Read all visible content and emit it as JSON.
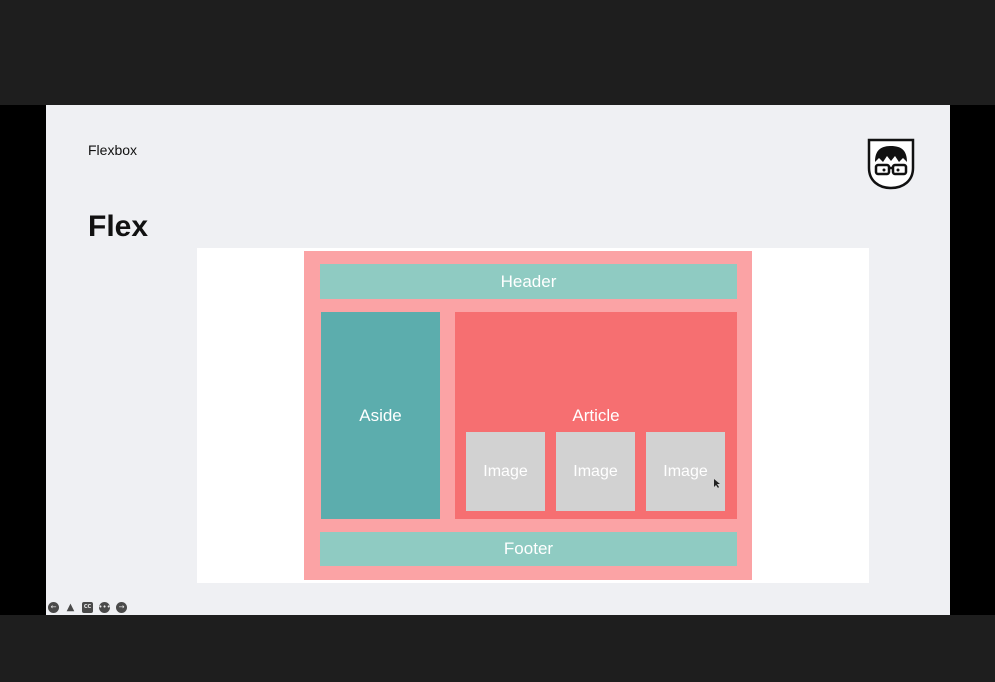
{
  "slide": {
    "section": "Flexbox",
    "heading": "Flex"
  },
  "logo": {
    "icon": "nerd-glasses-shield-icon"
  },
  "layout_demo": {
    "header": "Header",
    "aside": "Aside",
    "article": "Article",
    "images": [
      "Image",
      "Image",
      "Image"
    ],
    "footer": "Footer"
  },
  "colors": {
    "container": "#fba3a5",
    "header_footer": "#8fcbc2",
    "aside": "#5cadad",
    "article": "#f66f71",
    "image": "#d2d2d2"
  },
  "player_controls": [
    {
      "name": "previous-slide-icon",
      "glyph": "←"
    },
    {
      "name": "pointer-icon",
      "glyph": "▲"
    },
    {
      "name": "captions-icon",
      "glyph": "CC"
    },
    {
      "name": "more-options-icon",
      "glyph": "•••"
    },
    {
      "name": "next-slide-icon",
      "glyph": "→"
    }
  ]
}
